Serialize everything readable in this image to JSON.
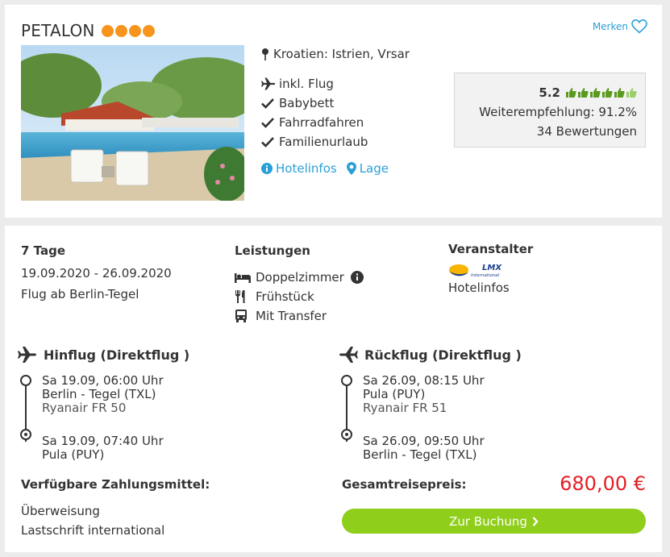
{
  "hotel": {
    "name": "PETALON",
    "stars": 4,
    "star_color": "#f7941d",
    "merken_label": "Merken",
    "location": "Kroatien: Istrien, Vrsar",
    "features": [
      {
        "icon": "plane-icon",
        "label": "inkl. Flug"
      },
      {
        "icon": "check-icon",
        "label": "Babybett"
      },
      {
        "icon": "check-icon",
        "label": "Fahrradfahren"
      },
      {
        "icon": "check-icon",
        "label": "Familienurlaub"
      }
    ],
    "links": {
      "hotelinfos": "Hotelinfos",
      "lage": "Lage"
    },
    "rating": {
      "score": "5.2",
      "thumbs_max": 6,
      "recommendation": "Weiterempfehlung: 91.2%",
      "reviews": "34 Bewertungen"
    }
  },
  "offer": {
    "duration": "7 Tage",
    "dates": "19.09.2020 - 26.09.2020",
    "departure": "Flug ab Berlin-Tegel",
    "leistungen_title": "Leistungen",
    "leistungen": [
      {
        "icon": "bed-icon",
        "label": "Doppelzimmer"
      },
      {
        "icon": "cutlery-icon",
        "label": "Frühstück"
      },
      {
        "icon": "bus-icon",
        "label": "Mit Transfer"
      }
    ],
    "veranstalter_title": "Veranstalter",
    "veranstalter_logo_text": "LMX",
    "veranstalter_logo_sub": "International",
    "veranstalter_link": "Hotelinfos"
  },
  "flights": {
    "outbound": {
      "title": "Hinflug (Direktflug )",
      "dep_time": "Sa 19.09, 06:00 Uhr",
      "dep_airport": "Berlin - Tegel (TXL)",
      "carrier": "Ryanair FR 50",
      "arr_time": "Sa 19.09, 07:40 Uhr",
      "arr_airport": "Pula (PUY)"
    },
    "return": {
      "title": "Rückflug (Direktflug )",
      "dep_time": "Sa 26.09, 08:15 Uhr",
      "dep_airport": "Pula (PUY)",
      "carrier": "Ryanair FR 51",
      "arr_time": "Sa 26.09, 09:50 Uhr",
      "arr_airport": "Berlin - Tegel (TXL)"
    }
  },
  "payment": {
    "title": "Verfügbare Zahlungsmittel:",
    "methods": [
      "Überweisung",
      "Lastschrift international"
    ]
  },
  "price": {
    "label": "Gesamtreisepreis:",
    "value": "680,00 €",
    "color": "#e31e24"
  },
  "booking": {
    "button_label": "Zur Buchung",
    "color": "#8fce1a"
  }
}
